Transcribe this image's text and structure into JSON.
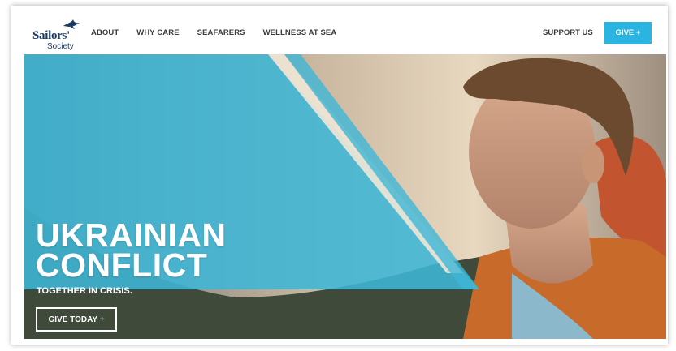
{
  "header": {
    "logo_text": "Sailors'",
    "logo_sub": "Society",
    "nav": [
      "ABOUT",
      "WHY CARE",
      "SEAFARERS",
      "WELLNESS AT SEA"
    ],
    "support_label": "SUPPORT US",
    "give_label": "GIVE +"
  },
  "hero": {
    "title_line1": "UKRAINIAN",
    "title_line2": "CONFLICT",
    "subtitle": "TOGETHER IN CRISIS.",
    "cta_label": "GIVE TODAY +"
  },
  "colors": {
    "accent": "#29b5e0",
    "brand": "#1d3a63",
    "overlay": "#3fb6d6"
  },
  "icons": {
    "logo_mark": "bird-icon"
  }
}
